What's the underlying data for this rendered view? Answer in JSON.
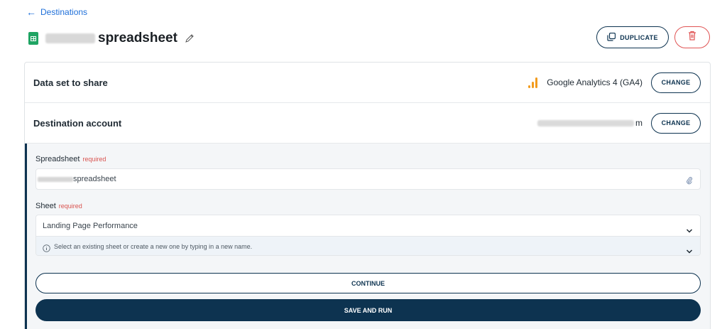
{
  "nav": {
    "back_arrow": "←",
    "back_label": "Destinations"
  },
  "header": {
    "title_hidden": "Untitled",
    "title_visible": "spreadsheet",
    "duplicate_label": "DUPLICATE",
    "icons": {
      "sheet": "google-sheets-icon",
      "edit": "pencil-icon",
      "duplicate": "copy-icon",
      "delete": "trash-icon"
    }
  },
  "dataset": {
    "label": "Data set to share",
    "value": "Google Analytics 4 (GA4)",
    "change_label": "CHANGE"
  },
  "destination": {
    "label": "Destination account",
    "email_tail": "m",
    "change_label": "CHANGE"
  },
  "form": {
    "spreadsheet": {
      "label": "Spreadsheet",
      "required": "required",
      "value": "spreadsheet"
    },
    "sheet": {
      "label": "Sheet",
      "required": "required",
      "value": "Landing Page Performance",
      "hint": "Select an existing sheet or create a new one by typing in a new name."
    },
    "continue_label": "CONTINUE",
    "save_run_label": "SAVE AND RUN"
  },
  "colors": {
    "primary": "#0d3350",
    "link": "#1e6fd9",
    "danger": "#e05454",
    "sheets_green": "#1fa463",
    "ga_orange": "#f29b1d"
  }
}
